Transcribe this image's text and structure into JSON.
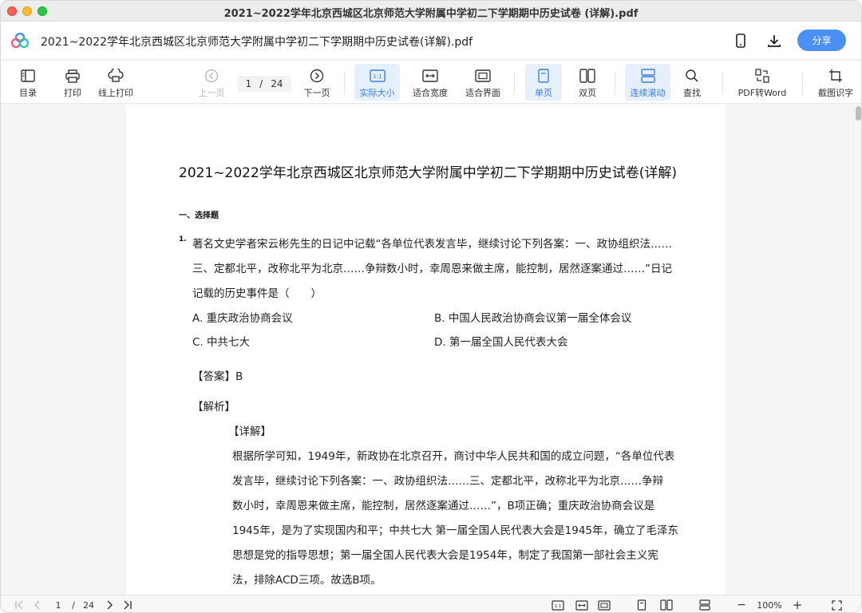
{
  "window": {
    "title": "2021~2022学年北京西城区北京师范大学附属中学初二下学期期中历史试卷 (详解).pdf"
  },
  "header": {
    "doc_name": "2021~2022学年北京西城区北京师范大学附属中学初二下学期期中历史试卷(详解).pdf",
    "share_label": "分享"
  },
  "toolbar": {
    "toc": "目录",
    "print": "打印",
    "online_print": "线上打印",
    "prev": "上一页",
    "page_current": "1",
    "page_sep": "/",
    "page_total": "24",
    "next": "下一页",
    "actual_size": "实际大小",
    "fit_width": "适合宽度",
    "fit_page": "适合界面",
    "single": "单页",
    "double": "双页",
    "continuous": "连续滚动",
    "find": "查找",
    "pdf_to_word": "PDF转Word",
    "ocr": "截图识字",
    "actual_size_icon_text": "1:1"
  },
  "document": {
    "title": "2021~2022学年北京西城区北京师范大学附属中学初二下学期期中历史试卷(详解)",
    "section": "一、选择题",
    "qnum": "1.",
    "question_lines": [
      "著名文史学者宋云彬先生的日记中记载“各单位代表发言毕，继续讨论下列各案：一、政协组织法……",
      "三、定都北平，改称北平为北京……争辩数小时，幸周恩来做主席，能控制，居然逐案通过……”日记",
      "记载的历史事件是（　　）"
    ],
    "options": {
      "a": "A. 重庆政治协商会议",
      "b": "B. 中国人民政治协商会议第一届全体会议",
      "c": "C. 中共七大",
      "d": "D. 第一届全国人民代表大会"
    },
    "answer": "【答案】B",
    "analysis": "【解析】",
    "detail": "【详解】",
    "detail_lines": [
      "根据所学可知，1949年，新政协在北京召开，商讨中华人民共和国的成立问题，“各单位代表",
      "发言毕，继续讨论下列各案：一、政协组织法……三、定都北平，改称北平为北京……争辩",
      "数小时，幸周恩来做主席，能控制，居然逐案通过……”，B项正确；重庆政治协商会议是",
      "1945年，是为了实现国内和平；中共七大 第一届全国人民代表大会是1945年，确立了毛泽东",
      "思想是党的指导思想；第一届全国人民代表大会是1954年，制定了我国第一部社会主义宪",
      "法，排除ACD三项。故选B项。"
    ]
  },
  "statusbar": {
    "page_current": "1",
    "page_sep": "/",
    "page_total": "24",
    "zoom": "100%",
    "minus": "−",
    "plus": "+",
    "actual_size_icon_text": "1:1"
  },
  "colors": {
    "accent": "#4a90f5",
    "active_bg": "#e6f0fd",
    "active_text": "#3a7ee8"
  }
}
